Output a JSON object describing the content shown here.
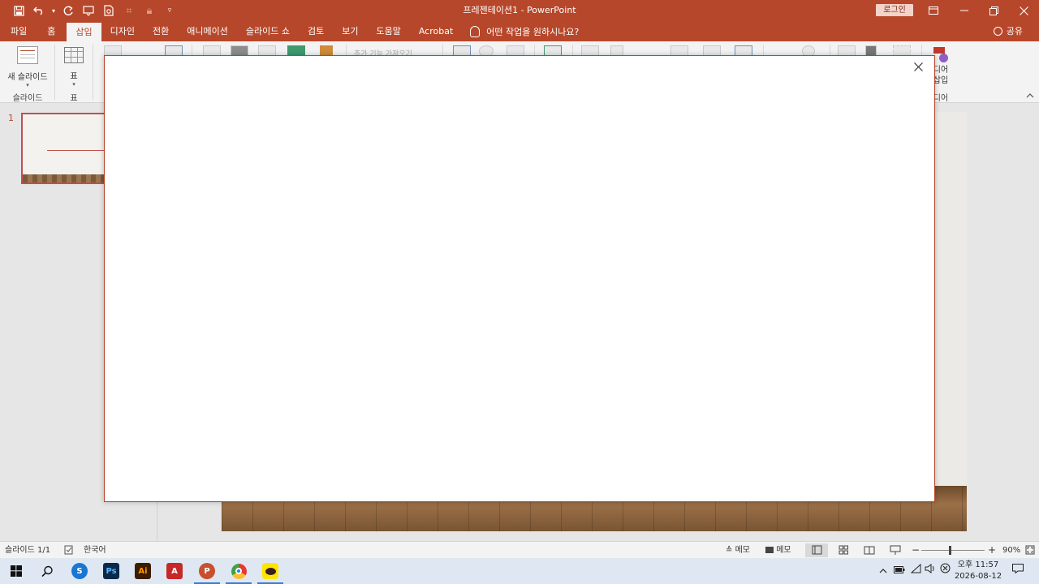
{
  "window": {
    "title": "프레젠테이션1  -  PowerPoint",
    "signin_label": "로그인",
    "controls": [
      "ribbon-display-options",
      "minimize",
      "restore",
      "close"
    ]
  },
  "quick_access": [
    "save-icon",
    "undo-icon",
    "redo-icon",
    "start-from-beginning-icon",
    "print-preview-icon",
    "format-painter-icon",
    "lock-icon",
    "customize-icon"
  ],
  "tabs": [
    {
      "label": "파일",
      "active": false
    },
    {
      "label": "홈",
      "active": false
    },
    {
      "label": "삽입",
      "active": true
    },
    {
      "label": "디자인",
      "active": false
    },
    {
      "label": "전환",
      "active": false
    },
    {
      "label": "애니메이션",
      "active": false
    },
    {
      "label": "슬라이드 쇼",
      "active": false
    },
    {
      "label": "검토",
      "active": false
    },
    {
      "label": "보기",
      "active": false
    },
    {
      "label": "도움말",
      "active": false
    },
    {
      "label": "Acrobat",
      "active": false
    }
  ],
  "tell_me": "어떤 작업을 원하시나요?",
  "share_label": "공유",
  "ribbon": {
    "new_slide_label": "새 슬라이드",
    "slides_group": "슬라이드",
    "table_label": "표",
    "table_group": "표",
    "addins_partial": "추가 기능 가져오기",
    "media_partial_1": "디어",
    "media_partial_2": "삽입",
    "media_partial_3": "디어"
  },
  "thumbnail": {
    "number": "1"
  },
  "status": {
    "slide_counter": "슬라이드 1/1",
    "language": "한국어",
    "notes_label": "메모",
    "comments_label": "메모",
    "zoom_minus": "−",
    "zoom_plus": "+",
    "zoom_level": "90%",
    "zoom_value": 90
  },
  "taskbar": {
    "apps": [
      {
        "name": "start",
        "icon": "windows-icon"
      },
      {
        "name": "search",
        "icon": "search-icon"
      },
      {
        "name": "skype",
        "label": "S",
        "color": "#1976d2"
      },
      {
        "name": "photoshop",
        "label": "Ps",
        "color": "#0b2a4a"
      },
      {
        "name": "illustrator",
        "label": "Ai",
        "color": "#3b1d00"
      },
      {
        "name": "acrobat",
        "label": "A",
        "color": "#c62828"
      },
      {
        "name": "powerpoint",
        "label": "P",
        "color": "#c8502e"
      },
      {
        "name": "chrome",
        "label": "",
        "color": "#e53935"
      },
      {
        "name": "kakaotalk",
        "label": "",
        "color": "#fee500"
      }
    ],
    "clock_time": "오후 11:57",
    "clock_date": "2026-08-12"
  }
}
